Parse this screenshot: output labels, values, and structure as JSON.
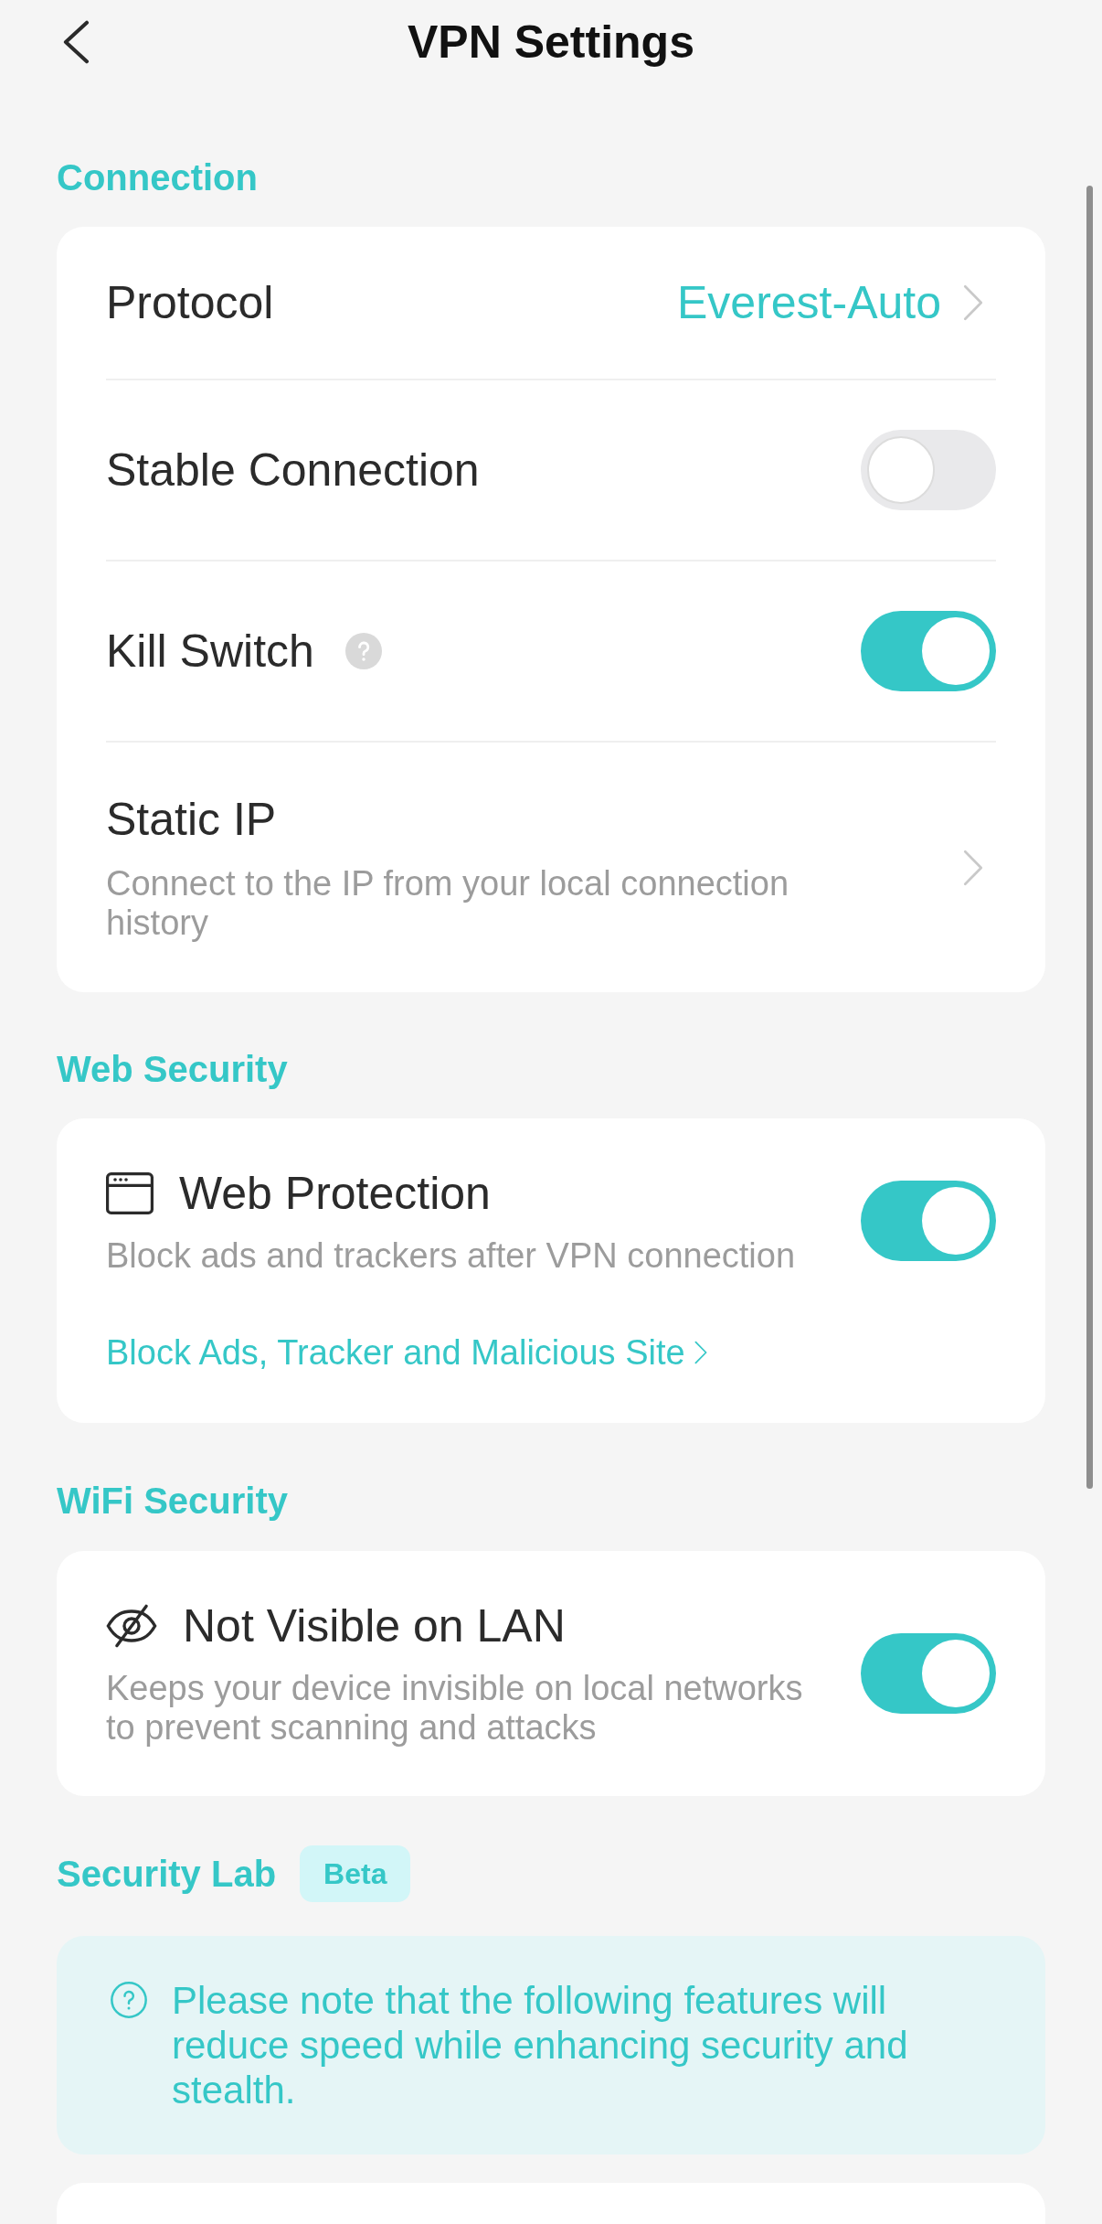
{
  "header": {
    "title": "VPN Settings"
  },
  "connection": {
    "title": "Connection",
    "rows": [
      {
        "kind": "value",
        "label": "Protocol",
        "value": "Everest-Auto"
      },
      {
        "kind": "toggle",
        "label": "Stable Connection",
        "on": false
      },
      {
        "kind": "toggle",
        "label": "Kill Switch",
        "help": true,
        "on": true
      },
      {
        "kind": "link",
        "label": "Static IP",
        "description": "Connect to the IP from your local connection history"
      }
    ]
  },
  "web_security": {
    "title": "Web Security",
    "feature": {
      "label": "Web Protection",
      "description": "Block ads and trackers after VPN connection",
      "on": true,
      "link": "Block Ads, Tracker and Malicious Site"
    }
  },
  "wifi_security": {
    "title": "WiFi Security",
    "feature": {
      "label": "Not Visible on LAN",
      "description": "Keeps your device invisible on local networks to prevent scanning and attacks",
      "on": true
    }
  },
  "security_lab": {
    "title": "Security Lab",
    "badge": "Beta",
    "note": "Please note that the following features will reduce speed while enhancing security and stealth."
  }
}
